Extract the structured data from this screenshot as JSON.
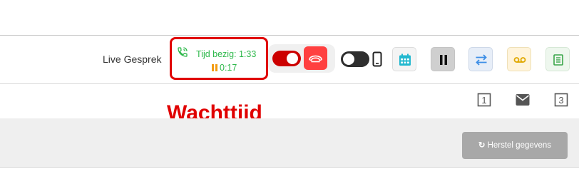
{
  "call": {
    "title": "Live Gesprek",
    "busy_label": "Tijd bezig: 1:33",
    "hold_time": "0:17",
    "status_color": "#2eb84b",
    "hold_color": "#f39c12"
  },
  "annotation": {
    "label": "Wachttijd",
    "color": "#e00000"
  },
  "toolbar": {
    "buttons": [
      {
        "icon": "calendar-icon"
      },
      {
        "icon": "pause-icon"
      },
      {
        "icon": "transfer-icon"
      },
      {
        "icon": "voicemail-icon"
      },
      {
        "icon": "phonebook-icon"
      }
    ],
    "toggles": {
      "call_toggle": "on",
      "device_toggle": "off"
    }
  },
  "tabs": [
    {
      "label": "1"
    },
    {
      "icon": "envelope-icon"
    },
    {
      "label": "3"
    }
  ],
  "actions": {
    "reset_label": "Herstel gegevens"
  }
}
